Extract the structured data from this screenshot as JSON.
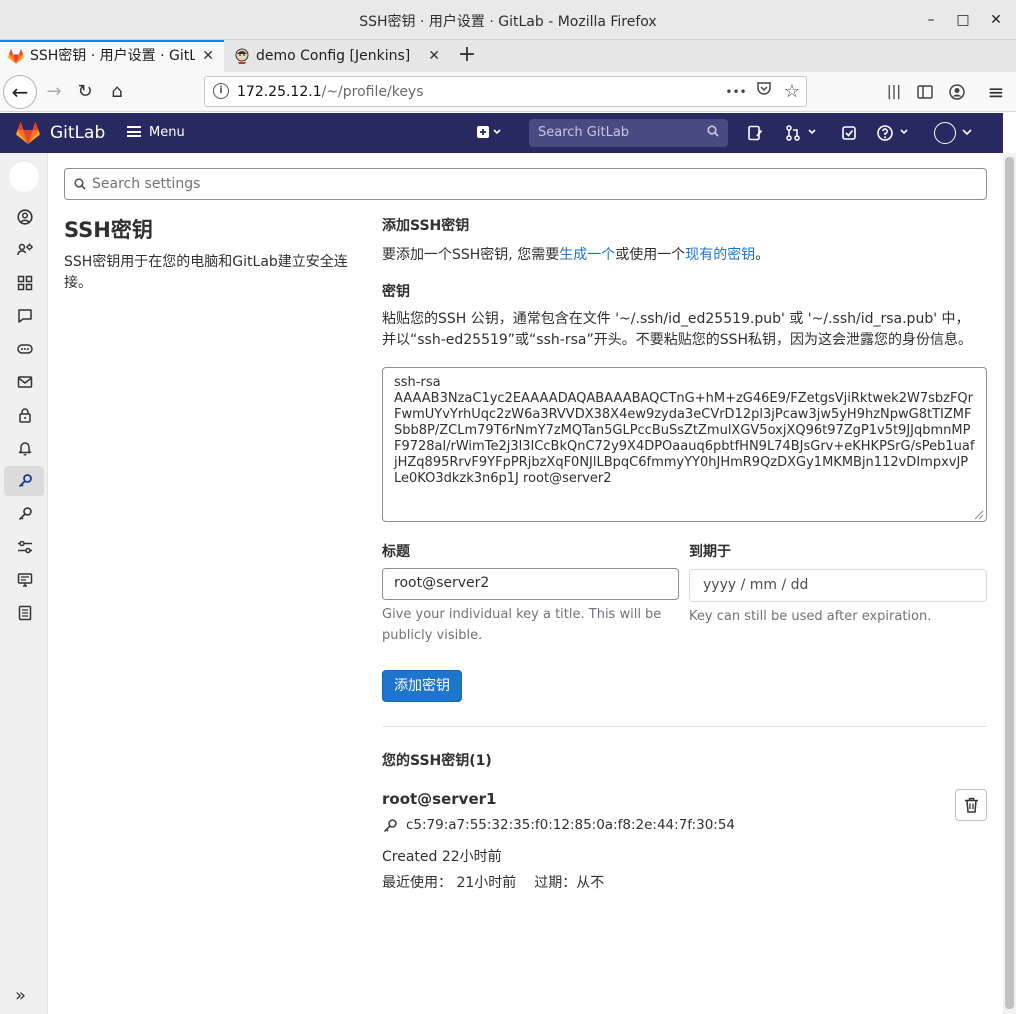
{
  "window": {
    "title": "SSH密钥 · 用户设置 · GitLab - Mozilla Firefox",
    "minimize": "–",
    "maximize": "□",
    "close": "✕"
  },
  "tabs": [
    {
      "label": "SSH密钥 · 用户设置 · GitL",
      "close": "✕",
      "active": true
    },
    {
      "label": "demo Config [Jenkins]",
      "close": "✕",
      "active": false
    }
  ],
  "new_tab": "+",
  "navbar": {
    "back": "←",
    "forward": "→",
    "reload": "↻",
    "home": "⌂",
    "url_host": "172.25.12.1",
    "url_path": "/~/profile/keys",
    "page_actions": "•••",
    "bookmark": "☆",
    "library": "|||",
    "menu": "≡"
  },
  "gitlab": {
    "brand": "GitLab",
    "menu_label": "Menu",
    "search_placeholder": "Search GitLab",
    "brand_color": "#292961"
  },
  "settings_search_placeholder": "Search settings",
  "left": {
    "title": "SSH密钥",
    "description": "SSH密钥用于在您的电脑和GitLab建立安全连接。"
  },
  "add_section": {
    "heading": "添加SSH密钥",
    "intro_prefix": "要添加一个SSH密钥, 您需要",
    "link_generate": "生成一个",
    "intro_middle": "或使用一个",
    "link_existing": "现有的密钥",
    "intro_suffix": "。",
    "key_heading": "密钥",
    "key_help": "粘贴您的SSH 公钥，通常包含在文件 '~/.ssh/id_ed25519.pub' 或 '~/.ssh/id_rsa.pub' 中，并以“ssh-ed25519”或“ssh-rsa”开头。不要粘贴您的SSH私钥，因为这会泄露您的身份信息。",
    "key_value": "ssh-rsa\nAAAAB3NzaC1yc2EAAAADAQABAAABAQCTnG+hM+zG46E9/FZetgsVjiRktwek2W7sbzFQrFwmUYvYrhUqc2zW6a3RVVDX38X4ew9zyda3eCVrD12pl3jPcaw3jw5yH9hzNpwG8tTIZMFSbb8P/ZCLm79T6rNmY7zMQTan5GLPccBuSsZtZmulXGV5oxjXQ96t97ZgP1v5t9JJqbmnMPF9728al/rWimTe2j3l3ICcBkQnC72y9X4DPOaauq6pbtfHN9L74BJsGrv+eKHKPSrG/sPeb1uafjHZq895RrvF9YFpPRjbzXqF0NJlLBpqC6fmmyYY0hJHmR9QzDXGy1MKMBjn112vDImpxvJPLe0KO3dkzk3n6p1J root@server2",
    "title_label": "标题",
    "title_value": "root@server2",
    "title_help": "Give your individual key a title. This will be publicly visible.",
    "expires_label": "到期于",
    "expires_placeholder": "yyyy / mm / dd",
    "expires_help": "Key can still be used after expiration.",
    "submit_label": "添加密钥",
    "button_color": "#1f75cb"
  },
  "keys_section": {
    "heading": "您的SSH密钥(1)",
    "keys": [
      {
        "title": "root@server1",
        "fingerprint": "c5:79:a7:55:32:35:f0:12:85:0a:f8:2e:44:7f:30:54",
        "created": "Created 22小时前",
        "last_used": "最近使用：  21小时前",
        "expires": "过期：从不"
      }
    ]
  }
}
